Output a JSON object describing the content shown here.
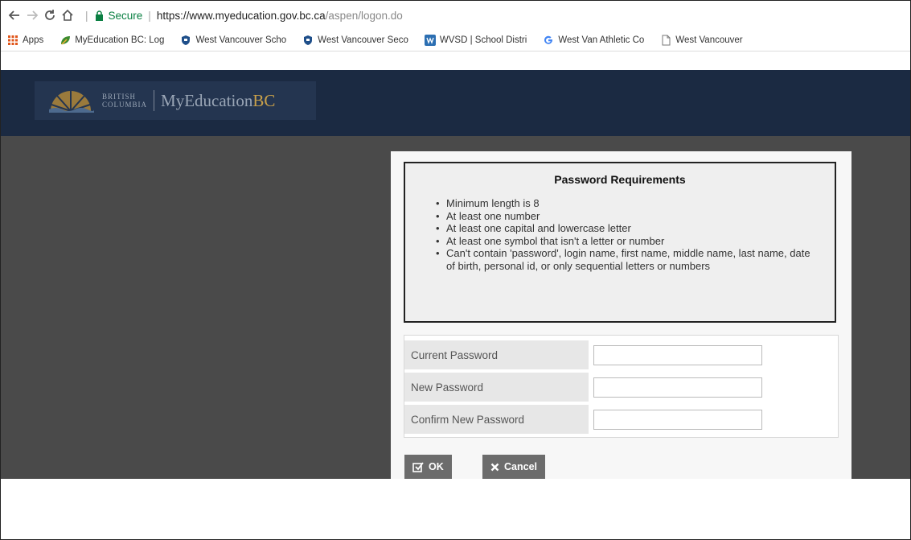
{
  "browser": {
    "secure_label": "Secure",
    "url_host": "https://www.myeducation.gov.bc.ca",
    "url_path": "/aspen/logon.do",
    "bookmarks": [
      {
        "label": "Apps",
        "icon": "apps-grid-icon",
        "color": "#e0561b"
      },
      {
        "label": "MyEducation BC: Log",
        "icon": "leaf-icon",
        "color": "#3d8b2f"
      },
      {
        "label": "West Vancouver Scho",
        "icon": "shield-icon",
        "color": "#1f4f8a"
      },
      {
        "label": "West Vancouver Seco",
        "icon": "shield-icon",
        "color": "#1f4f8a"
      },
      {
        "label": "WVSD | School Distri",
        "icon": "wvsd-icon",
        "color": "#2c6fb2"
      },
      {
        "label": "West Van Athletic Co",
        "icon": "google-icon",
        "color": "#4285f4"
      },
      {
        "label": "West Vancouver",
        "icon": "page-icon",
        "color": "#888888"
      }
    ]
  },
  "header": {
    "logo_line1": "BRITISH",
    "logo_line2": "COLUMBIA",
    "logo_app": "MyEducation",
    "logo_app_suffix": "BC"
  },
  "requirements": {
    "title": "Password Requirements",
    "items": [
      "Minimum length is 8",
      "At least one number",
      "At least one capital and lowercase letter",
      "At least one symbol that isn't a letter or number",
      "Can't contain 'password', login name, first name, middle name, last name, date of birth, personal id, or only sequential letters or numbers"
    ]
  },
  "form": {
    "current_label": "Current Password",
    "current_value": "",
    "new_label": "New Password",
    "new_value": "",
    "confirm_label": "Confirm New Password",
    "confirm_value": ""
  },
  "buttons": {
    "ok_label": "OK",
    "cancel_label": "Cancel"
  },
  "colors": {
    "header_bg": "#1b2a42",
    "page_bg": "#4a4a4a",
    "button_bg": "#6c6c6c",
    "secure_green": "#0b8043"
  }
}
